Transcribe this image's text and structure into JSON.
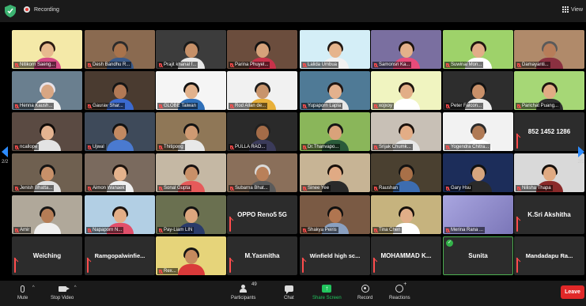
{
  "topbar": {
    "recording_label": "Recording",
    "view_label": "View"
  },
  "pagination": {
    "left": "2/2",
    "right": "2/2"
  },
  "tiles": [
    {
      "name": "Nitikorn Saeng...",
      "muted": true,
      "bg": "#f4e9a8",
      "skin": "#e7b98e",
      "hair": "#2a1a12",
      "shirt": "#d64a86"
    },
    {
      "name": "Desh Bandhu R...",
      "muted": true,
      "bg": "#8a6a50",
      "skin": "#a8734c",
      "hair": "#2b2b2b",
      "shirt": "#3a5a8a"
    },
    {
      "name": "Prajit khanal f...",
      "muted": true,
      "bg": "#3c3c3c",
      "skin": "#c69068",
      "hair": "#1a1a1a",
      "shirt": "#e8e8e8"
    },
    {
      "name": "Parina Phuyel...",
      "muted": true,
      "bg": "#6b4d3d",
      "skin": "#d6a27a",
      "hair": "#111111",
      "shirt": "#c8324a"
    },
    {
      "name": "Lalida Umbua",
      "muted": true,
      "bg": "#d4eef7",
      "skin": "#e6b48c",
      "hair": "#221712",
      "shirt": "#f1f1f1"
    },
    {
      "name": "Samonsri Ka...",
      "muted": true,
      "bg": "#7a6fa0",
      "skin": "#e4b08a",
      "hair": "#1b120d",
      "shirt": "#e84b7a"
    },
    {
      "name": "Suwinai Mon...",
      "muted": true,
      "bg": "#9ed26a",
      "skin": "#e1ad88",
      "hair": "#201510",
      "shirt": "#ffffff"
    },
    {
      "name": "Damayanti...",
      "muted": true,
      "bg": "#b08a6a",
      "skin": "#b77d59",
      "hair": "#5a5a5a",
      "shirt": "#8a3040"
    },
    {
      "name": "Henna Kaush...",
      "muted": true,
      "bg": "#6a7f8f",
      "skin": "#d8a683",
      "hair": "#e8e2e8",
      "shirt": "#f2f2f2"
    },
    {
      "name": "Gaurav Shar...",
      "muted": true,
      "bg": "#4a3b30",
      "skin": "#b27955",
      "hair": "#151515",
      "shirt": "#3b6ad0"
    },
    {
      "name": "GLOBE Taiwan",
      "muted": true,
      "bg": "#f5f5f5",
      "skin": "#e2b28c",
      "hair": "#111111",
      "shirt": "#2f6fb8"
    },
    {
      "name": "Rod Allan de...",
      "muted": true,
      "bg": "#f1f1f1",
      "skin": "#c8946c",
      "hair": "#1a1a1a",
      "shirt": "#e8b03a"
    },
    {
      "name": "Yupaporn Lapla",
      "muted": true,
      "bg": "#4f7a96",
      "skin": "#e3b18d",
      "hair": "#1f1410",
      "shirt": "#e8e8e8"
    },
    {
      "name": "xojxoy",
      "muted": true,
      "bg": "#f0f4c0",
      "skin": "#e2ae87",
      "hair": "#1c130e",
      "shirt": "#ffffff"
    },
    {
      "name": "Peter Falcon...",
      "muted": true,
      "bg": "#2d2d2d",
      "skin": "#c99069",
      "hair": "#111111",
      "shirt": "#eeeeee"
    },
    {
      "name": "Parichat Puang...",
      "muted": true,
      "bg": "#a6d776",
      "skin": "#e0ab84",
      "hair": "#1d130e",
      "shirt": "#2e2e2e"
    },
    {
      "name": "ncallope",
      "muted": true,
      "bg": "#5a4a42",
      "skin": "#e4b491",
      "hair": "#100b08",
      "shirt": "#e3e3e3"
    },
    {
      "name": "Ujwal",
      "muted": true,
      "bg": "#3e4a5a",
      "skin": "#c28a62",
      "hair": "#111111",
      "shirt": "#4a7ad0"
    },
    {
      "name": "Thitipong",
      "muted": true,
      "bg": "#8f7757",
      "skin": "#cf9a72",
      "hair": "#121212",
      "shirt": "#e8e8e8"
    },
    {
      "name": "PULLA RAO...",
      "muted": true,
      "bg": "#2a2a2a",
      "skin": "#a46c48",
      "hair": "#202020",
      "shirt": "#3b3b5a"
    },
    {
      "name": "Dr.Thanvapo...",
      "muted": true,
      "bg": "#8ab65a",
      "skin": "#d9a27a",
      "hair": "#151515",
      "shirt": "#2a5a3a"
    },
    {
      "name": "Srijak Chumk...",
      "muted": true,
      "bg": "#c8c0b6",
      "skin": "#e3ad86",
      "hair": "#1a110c",
      "shirt": "#e7e7e7"
    },
    {
      "name": "Yogendra Chitra...",
      "muted": true,
      "bg": "#f2f2f2",
      "skin": "#b07a55",
      "hair": "#2a2a2a",
      "shirt": "#ffffff"
    },
    {
      "name": "852 1452 1286",
      "muted": true,
      "name_only": true
    },
    {
      "name": "Jenish Bhatta...",
      "muted": true,
      "bg": "#6f6050",
      "skin": "#c79069",
      "hair": "#141414",
      "shirt": "#e0e0e0"
    },
    {
      "name": "Aimon Wanaek",
      "muted": true,
      "bg": "#7a6a5e",
      "skin": "#e4b28c",
      "hair": "#1b120d",
      "shirt": "#f0f0f0"
    },
    {
      "name": "Sonal Gupta",
      "muted": true,
      "bg": "#c5b8a4",
      "skin": "#c99068",
      "hair": "#161010",
      "shirt": "#e65a5a"
    },
    {
      "name": "Subarna Bhat...",
      "muted": true,
      "bg": "#8a6f5a",
      "skin": "#b98059",
      "hair": "#dadada",
      "shirt": "#5a5a5a"
    },
    {
      "name": "Sinee Yee",
      "muted": true,
      "bg": "#c7b495",
      "skin": "#e0aa84",
      "hair": "#18100b",
      "shirt": "#2a2a2a"
    },
    {
      "name": "Raushan",
      "muted": true,
      "bg": "#4a4030",
      "skin": "#a87048",
      "hair": "#121212",
      "shirt": "#3d6db0"
    },
    {
      "name": "Gary Hsu",
      "muted": true,
      "bg": "#1c2d5a",
      "skin": "#d6a57e",
      "hair": "#101010",
      "shirt": "#2a2a2a"
    },
    {
      "name": "Nilisha Thapa",
      "muted": true,
      "bg": "#d9d9d9",
      "skin": "#e0aa82",
      "hair": "#140e0a",
      "shirt": "#8a2a2a"
    },
    {
      "name": "Amir",
      "muted": true,
      "bg": "#b0a89a",
      "skin": "#b57d56",
      "hair": "#161616",
      "shirt": "#f0f0f0"
    },
    {
      "name": "Napaporn N...",
      "muted": true,
      "bg": "#b2cfe4",
      "skin": "#e3ae87",
      "hair": "#1a110c",
      "shirt": "#e24f6a"
    },
    {
      "name": "Pay-Liam LIN",
      "muted": true,
      "bg": "#6a7050",
      "skin": "#dca67e",
      "hair": "#111111",
      "shirt": "#2a3b6a"
    },
    {
      "name": "OPPO Reno5 5G",
      "muted": true,
      "name_only": true
    },
    {
      "name": "Shakya Peiris",
      "muted": true,
      "bg": "#7a5a44",
      "skin": "#b07550",
      "hair": "#101010",
      "shirt": "#8aa0c0"
    },
    {
      "name": "Tina Chen",
      "muted": true,
      "bg": "#c6b37e",
      "skin": "#e1ae88",
      "hair": "#150f0b",
      "shirt": "#ffffff"
    },
    {
      "name": "Merina Rana ...",
      "muted": true,
      "blur": true,
      "bg": "#8a86c4"
    },
    {
      "name": "K.Sri Akshitha",
      "muted": true,
      "name_only": true
    },
    {
      "name": "Weiching",
      "muted": true,
      "name_only": true
    },
    {
      "name": "Ramgopalwinfie...",
      "muted": true,
      "name_only": true
    },
    {
      "name": "Rex...",
      "muted": true,
      "bg": "#e6d47a",
      "skin": "#c58a5e",
      "hair": "#141414",
      "shirt": "#d93a3a"
    },
    {
      "name": "M.Yasmitha",
      "muted": true,
      "name_only": true
    },
    {
      "name": "Winfield high sc...",
      "muted": true,
      "name_only": true
    },
    {
      "name": "MOHAMMAD K...",
      "muted": true,
      "name_only": true
    },
    {
      "name": "Sunita",
      "muted": false,
      "name_only": true,
      "active": true
    },
    {
      "name": "Mandadapu Ra...",
      "muted": true,
      "name_only": true
    }
  ],
  "toolbar": {
    "mute": "Mute",
    "stop_video": "Stop Video",
    "participants": "Participants",
    "participants_count": "49",
    "chat": "Chat",
    "share_screen": "Share Screen",
    "record": "Record",
    "reactions": "Reactions",
    "leave": "Leave"
  },
  "colors": {
    "accent": "#2d8cff",
    "leave": "#e02828",
    "share": "#22c55e",
    "active_border": "#4caf50"
  }
}
